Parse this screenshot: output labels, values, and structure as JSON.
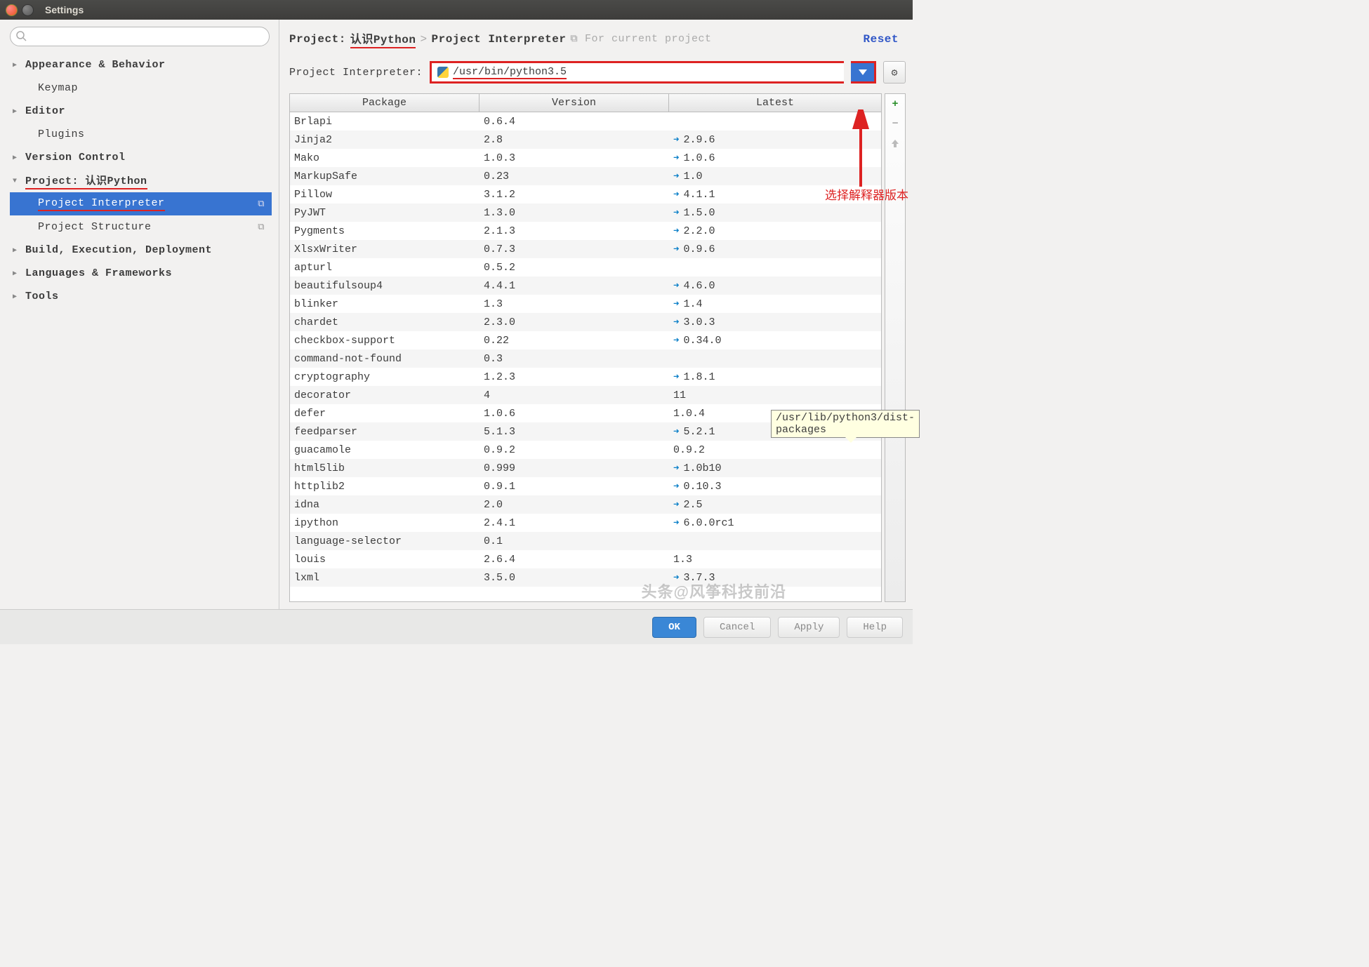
{
  "window": {
    "title": "Settings"
  },
  "search": {
    "placeholder": ""
  },
  "sidebar": {
    "items": [
      {
        "label": "Appearance & Behavior",
        "indent": 0,
        "arrow": "right"
      },
      {
        "label": "Keymap",
        "indent": 1,
        "arrow": "none"
      },
      {
        "label": "Editor",
        "indent": 0,
        "arrow": "right"
      },
      {
        "label": "Plugins",
        "indent": 1,
        "arrow": "none"
      },
      {
        "label": "Version Control",
        "indent": 0,
        "arrow": "right"
      },
      {
        "label": "Project: 认识Python",
        "indent": 0,
        "arrow": "down",
        "redline": true
      },
      {
        "label": "Project Interpreter",
        "indent": 2,
        "selected": true,
        "redline": true,
        "copy": true
      },
      {
        "label": "Project Structure",
        "indent": 2,
        "copy": true
      },
      {
        "label": "Build, Execution, Deployment",
        "indent": 0,
        "arrow": "right"
      },
      {
        "label": "Languages & Frameworks",
        "indent": 0,
        "arrow": "right"
      },
      {
        "label": "Tools",
        "indent": 0,
        "arrow": "right"
      }
    ]
  },
  "breadcrumb": {
    "project_label": "Project:",
    "project_name": "认识Python",
    "page": "Project Interpreter",
    "scope": "For current project",
    "reset": "Reset"
  },
  "interpreter": {
    "label": "Project Interpreter:",
    "value": "/usr/bin/python3.5"
  },
  "table": {
    "headers": {
      "package": "Package",
      "version": "Version",
      "latest": "Latest"
    },
    "rows": [
      {
        "pkg": "Brlapi",
        "ver": "0.6.4",
        "lat": "",
        "up": false
      },
      {
        "pkg": "Jinja2",
        "ver": "2.8",
        "lat": "2.9.6",
        "up": true
      },
      {
        "pkg": "Mako",
        "ver": "1.0.3",
        "lat": "1.0.6",
        "up": true
      },
      {
        "pkg": "MarkupSafe",
        "ver": "0.23",
        "lat": "1.0",
        "up": true
      },
      {
        "pkg": "Pillow",
        "ver": "3.1.2",
        "lat": "4.1.1",
        "up": true
      },
      {
        "pkg": "PyJWT",
        "ver": "1.3.0",
        "lat": "1.5.0",
        "up": true
      },
      {
        "pkg": "Pygments",
        "ver": "2.1.3",
        "lat": "2.2.0",
        "up": true
      },
      {
        "pkg": "XlsxWriter",
        "ver": "0.7.3",
        "lat": "0.9.6",
        "up": true
      },
      {
        "pkg": "apturl",
        "ver": "0.5.2",
        "lat": "",
        "up": false
      },
      {
        "pkg": "beautifulsoup4",
        "ver": "4.4.1",
        "lat": "4.6.0",
        "up": true
      },
      {
        "pkg": "blinker",
        "ver": "1.3",
        "lat": "1.4",
        "up": true
      },
      {
        "pkg": "chardet",
        "ver": "2.3.0",
        "lat": "3.0.3",
        "up": true
      },
      {
        "pkg": "checkbox-support",
        "ver": "0.22",
        "lat": "0.34.0",
        "up": true
      },
      {
        "pkg": "command-not-found",
        "ver": "0.3",
        "lat": "",
        "up": false
      },
      {
        "pkg": "cryptography",
        "ver": "1.2.3",
        "lat": "1.8.1",
        "up": true
      },
      {
        "pkg": "decorator",
        "ver": "4",
        "lat": "11",
        "up": false
      },
      {
        "pkg": "defer",
        "ver": "1.0.6",
        "lat": "1.0.4",
        "up": false
      },
      {
        "pkg": "feedparser",
        "ver": "5.1.3",
        "lat": "5.2.1",
        "up": true
      },
      {
        "pkg": "guacamole",
        "ver": "0.9.2",
        "lat": "0.9.2",
        "up": false
      },
      {
        "pkg": "html5lib",
        "ver": "0.999",
        "lat": "1.0b10",
        "up": true
      },
      {
        "pkg": "httplib2",
        "ver": "0.9.1",
        "lat": "0.10.3",
        "up": true
      },
      {
        "pkg": "idna",
        "ver": "2.0",
        "lat": "2.5",
        "up": true
      },
      {
        "pkg": "ipython",
        "ver": "2.4.1",
        "lat": "6.0.0rc1",
        "up": true
      },
      {
        "pkg": "language-selector",
        "ver": "0.1",
        "lat": "",
        "up": false
      },
      {
        "pkg": "louis",
        "ver": "2.6.4",
        "lat": "1.3",
        "up": false
      },
      {
        "pkg": "lxml",
        "ver": "3.5.0",
        "lat": "3.7.3",
        "up": true
      }
    ]
  },
  "tooltip": "/usr/lib/python3/dist-packages",
  "annotation": "选择解释器版本",
  "footer": {
    "ok": "OK",
    "cancel": "Cancel",
    "apply": "Apply",
    "help": "Help"
  },
  "watermark": "头条@风筝科技前沿"
}
